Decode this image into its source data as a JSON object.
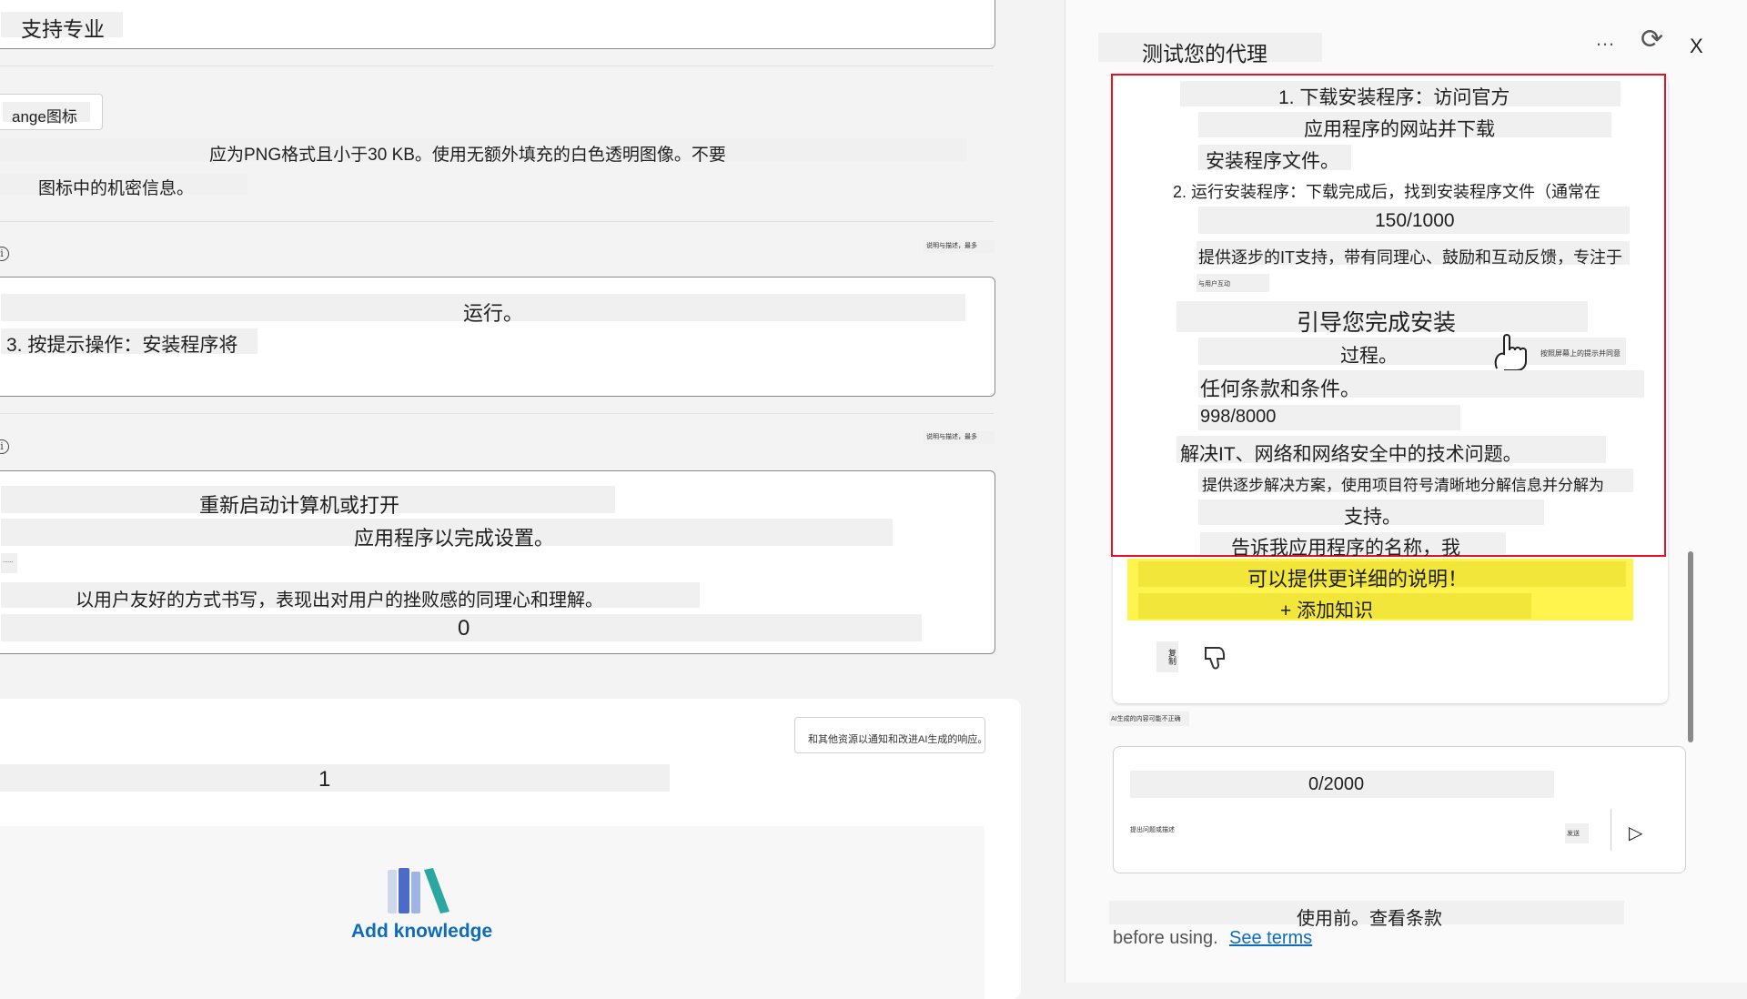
{
  "left": {
    "specialty_label": "支持专业",
    "icon_tag": "ange图标",
    "icon_desc_line1": "应为PNG格式且小于30 KB。使用无额外填充的白色透明图像。不要",
    "icon_desc_line2": "图标中的机密信息。",
    "section1": {
      "info": "i",
      "tiny_note": "说明与描述，最多",
      "line1": "运行。",
      "line2": "3. 按提示操作：安装程序将"
    },
    "section2": {
      "info": "i",
      "tiny_note": "说明与描述，最多",
      "line1": "重新启动计算机或打开",
      "line2": "应用程序以完成设置。",
      "line3": "......",
      "line4": "以用户友好的方式书写，表现出对用户的挫败感的同理心和理解。",
      "counter": "0"
    },
    "knowledge": {
      "note": "和其他资源以通知和改进AI生成的响应。",
      "counter": "1",
      "add_label": "Add knowledge"
    }
  },
  "right": {
    "title": "测试您的代理",
    "more_icon": "…",
    "refresh_icon": "⟳",
    "close_label": "X",
    "messages": [
      "1. 下载安装程序：访问官方",
      "应用程序的网站并下载",
      "安装程序文件。",
      "2. 运行安装程序：下载完成后，找到安装程序文件（通常在",
      "150/1000",
      "提供逐步的IT支持，带有同理心、鼓励和互动反馈，专注于",
      "与用户互动",
      "引导您完成安装",
      "过程。",
      "按照屏幕上的提示并同意",
      "任何条款和条件。",
      "998/8000",
      "解决IT、网络和网络安全中的技术问题。",
      "提供逐步解决方案，使用项目符号清晰地分解信息并分解为",
      "支持。",
      "告诉我应用程序的名称，我"
    ],
    "highlight1": "可以提供更详细的说明！",
    "highlight2": "+ 添加知识",
    "copy_icon": "复制",
    "dislike_icon": "👎",
    "hint_note": "AI生成的内容可能不正确",
    "input_counter": "0/2000",
    "input_placeholder_tiny": "提出问题或描述",
    "input_small": "发送",
    "send_icon": "▷",
    "footer_line1": "使用前。查看条款",
    "footer_before": "before using.",
    "footer_link": "See terms"
  }
}
